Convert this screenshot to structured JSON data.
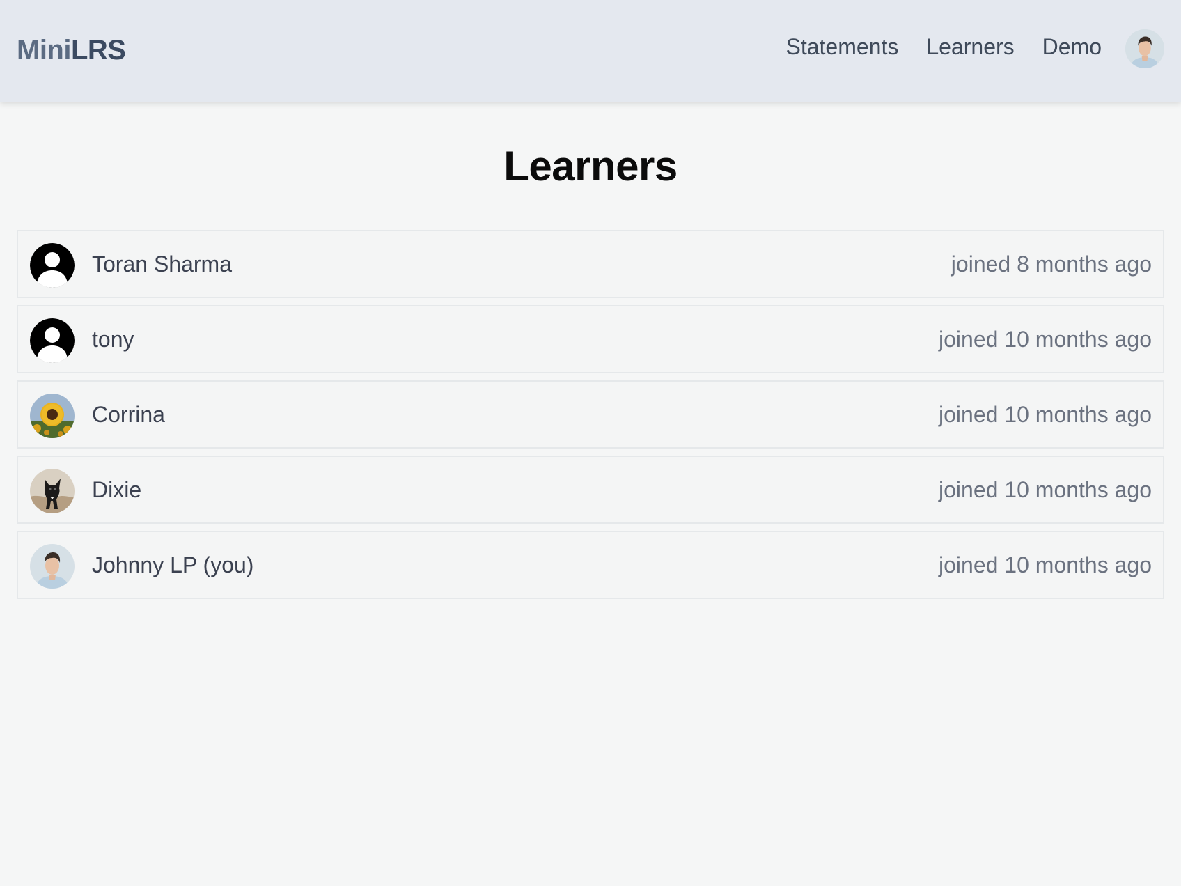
{
  "nav": {
    "brand_mini": "Mini",
    "brand_lrs": "LRS",
    "links": [
      "Statements",
      "Learners",
      "Demo"
    ],
    "user_avatar": "user-photo-avatar"
  },
  "page": {
    "title": "Learners"
  },
  "learners": [
    {
      "name": "Toran Sharma",
      "joined": "joined 8 months ago",
      "avatar": "default-user-icon"
    },
    {
      "name": "tony",
      "joined": "joined 10 months ago",
      "avatar": "default-user-icon"
    },
    {
      "name": "Corrina",
      "joined": "joined 10 months ago",
      "avatar": "sunflower-photo"
    },
    {
      "name": "Dixie",
      "joined": "joined 10 months ago",
      "avatar": "dog-photo"
    },
    {
      "name": "Johnny LP (you)",
      "joined": "joined 10 months ago",
      "avatar": "user-photo"
    }
  ],
  "colors": {
    "navbar_bg": "#e4e8ef",
    "page_bg": "#f5f6f6",
    "row_border": "#e5e8ea",
    "muted_text": "#6b7280"
  }
}
